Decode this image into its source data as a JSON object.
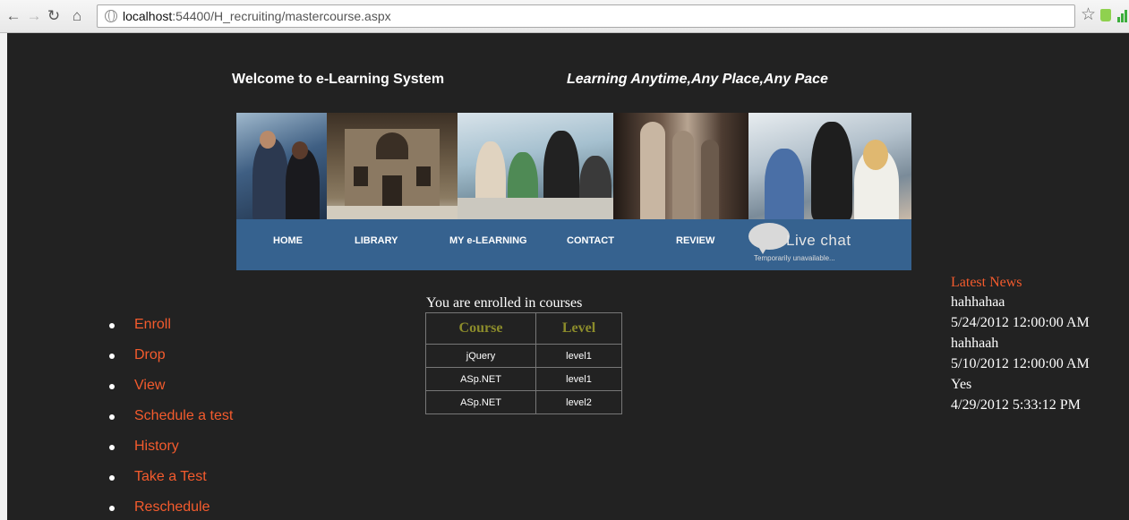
{
  "browser": {
    "url_host": "localhost",
    "url_path": ":54400/H_recruiting/mastercourse.aspx"
  },
  "header": {
    "welcome": "Welcome to e-Learning System",
    "tagline": "Learning Anytime,Any Place,Any Pace"
  },
  "nav": {
    "items": [
      "HOME",
      "LIBRARY",
      "MY e-LEARNING",
      "CONTACT",
      "REVIEW"
    ],
    "live_chat": {
      "label": "Live chat",
      "status": "Temporarily unavailable..."
    }
  },
  "side_menu": {
    "items": [
      "Enroll",
      "Drop",
      "View",
      "Schedule a test",
      "History",
      "Take a Test",
      "Reschedule"
    ]
  },
  "enrolled": {
    "caption": "You are enrolled in courses",
    "columns": [
      "Course",
      "Level"
    ],
    "rows": [
      [
        "jQuery",
        "level1"
      ],
      [
        "ASp.NET",
        "level1"
      ],
      [
        "ASp.NET",
        "level2"
      ]
    ]
  },
  "news": {
    "title": "Latest News",
    "items": [
      {
        "text": "hahhahaa",
        "date": "5/24/2012 12:00:00 AM"
      },
      {
        "text": "hahhaah",
        "date": "5/10/2012 12:00:00 AM"
      },
      {
        "text": "Yes",
        "date": "4/29/2012 5:33:12 PM"
      }
    ]
  },
  "colors": {
    "page_background": "#222222",
    "nav_background": "#36628f",
    "menu_link": "#f45b2d",
    "table_header": "#8c8c2b"
  }
}
